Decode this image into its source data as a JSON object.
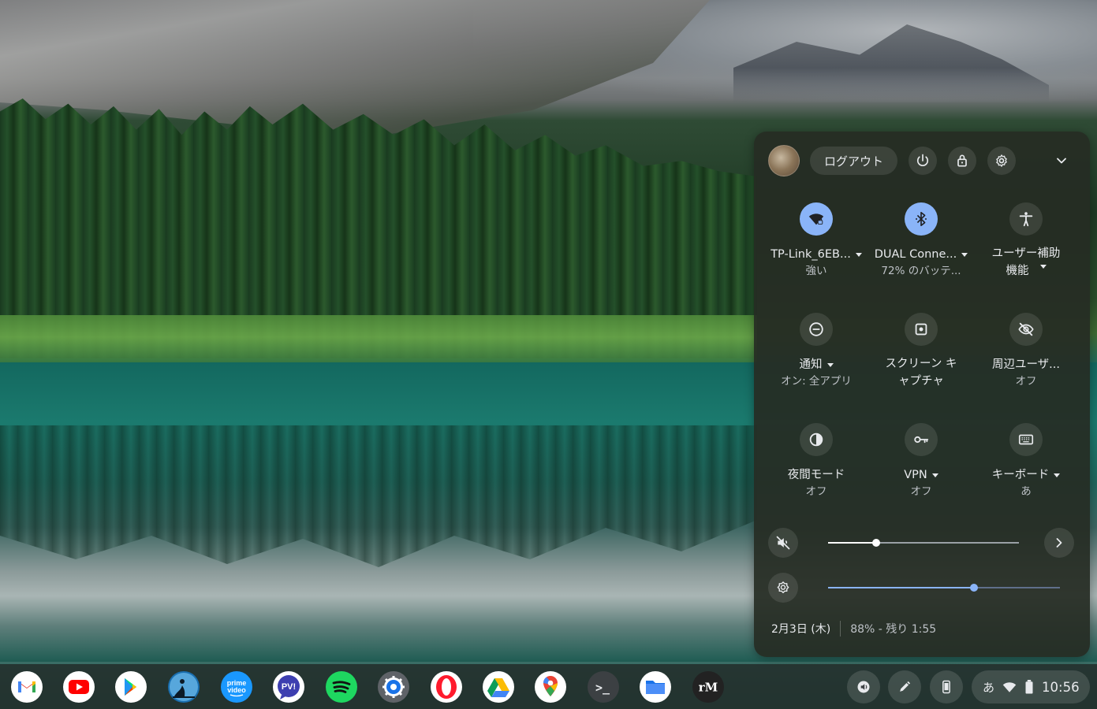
{
  "quick_settings": {
    "logout_label": "ログアウト",
    "tiles": [
      {
        "label": "TP-Link_6EB...",
        "sub": "強い"
      },
      {
        "label": "DUAL Conne...",
        "sub": "72% のバッテ..."
      },
      {
        "label_line1": "ユーザー補助",
        "label_line2": "機能"
      },
      {
        "label": "通知",
        "sub": "オン: 全アプリ"
      },
      {
        "label_line1": "スクリーン キ",
        "label_line2": "ャプチャ"
      },
      {
        "label": "周辺ユーザ...",
        "sub": "オフ"
      },
      {
        "label": "夜間モード",
        "sub": "オフ"
      },
      {
        "label": "VPN",
        "sub": "オフ"
      },
      {
        "label": "キーボード",
        "sub": "あ"
      }
    ],
    "volume_level": 0.25,
    "brightness_level": 0.63,
    "date": "2月3日 (木)",
    "battery": "88% - 残り 1:55",
    "accent_color": "#8ab4f8"
  },
  "shelf": {
    "apps": [
      "gmail-icon",
      "youtube-icon",
      "play-store-icon",
      "kindle-icon",
      "prime-video-icon",
      "pv-app-icon",
      "spotify-icon",
      "settings-icon",
      "opera-icon",
      "drive-icon",
      "maps-icon",
      "terminal-icon",
      "files-icon",
      "remarkable-icon"
    ],
    "prime_text_1": "prime",
    "prime_text_2": "video",
    "pv_text": "PV!",
    "rm_text": "rM",
    "terminal_text": ">_",
    "ime": "あ",
    "time": "10:56"
  }
}
